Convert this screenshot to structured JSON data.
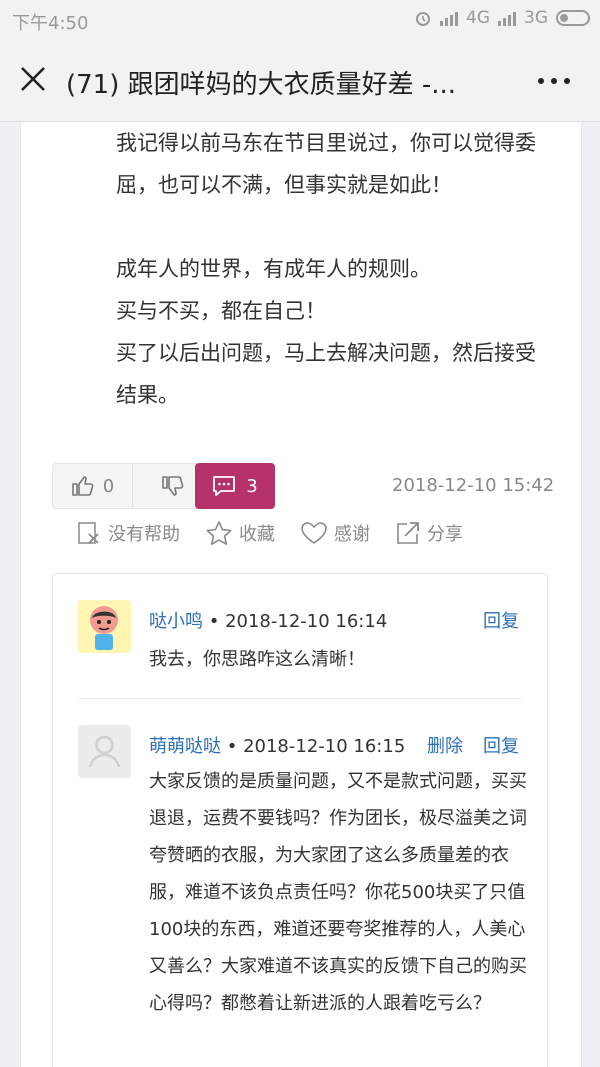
{
  "status_bar": {
    "time": "下午4:50",
    "net1": "4G",
    "net2": "3G"
  },
  "header": {
    "title": "(71) 跟团咩妈的大衣质量好差 -..."
  },
  "post": {
    "paragraphs": [
      "我记得以前马东在节目里说过，你可以觉得委屈，也可以不满，但事实就是如此！",
      "",
      "成年人的世界，有成年人的规则。",
      "买与不买，都在自己！",
      "买了以后出问题，马上去解决问题，然后接受结果。"
    ],
    "like_count": "0",
    "comment_count": "3",
    "date": "2018-12-10 15:42"
  },
  "actions": [
    {
      "label": "没有帮助",
      "icon": "not-helpful-icon"
    },
    {
      "label": "收藏",
      "icon": "star-icon"
    },
    {
      "label": "感谢",
      "icon": "heart-icon"
    },
    {
      "label": "分享",
      "icon": "share-icon"
    }
  ],
  "replies": [
    {
      "name": "哒小鸣",
      "time": "• 2018-12-10 16:14",
      "reply_label": "回复",
      "text": "我去，你思路咋这么清晰！"
    },
    {
      "name": "萌萌哒哒",
      "time": "• 2018-12-10 16:15",
      "delete_label": "删除",
      "reply_label": "回复",
      "text": "大家反馈的是质量问题，又不是款式问题，买买退退，运费不要钱吗？作为团长，极尽溢美之词夸赞晒的衣服，为大家团了这么多质量差的衣服，难道不该负点责任吗？你花500块买了只值100块的东西，难道还要夸奖推荐的人，人美心又善么？大家难道不该真实的反馈下自己的购买心得吗？都憋着让新进派的人跟着吃亏么？"
    }
  ],
  "colors": {
    "accent": "#b5336a",
    "link": "#2d6fb8"
  }
}
